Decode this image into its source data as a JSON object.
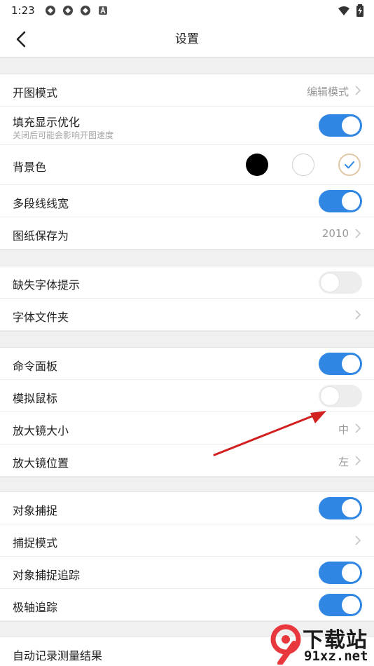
{
  "status_bar": {
    "time": "1:23",
    "notif_icons": [
      "sync-icon",
      "sync-icon",
      "sync-icon",
      "a-box-icon"
    ]
  },
  "header": {
    "title": "设置"
  },
  "settings": {
    "open_mode": {
      "label": "开图模式",
      "value": "编辑模式"
    },
    "fill_optimize": {
      "label": "填充显示优化",
      "sublabel": "关闭后可能会影响开图速度",
      "enabled": true
    },
    "background": {
      "label": "背景色",
      "options": [
        "#000000",
        "#ffffff",
        "#ffffff"
      ],
      "selected_index": 2
    },
    "polyline_width": {
      "label": "多段线线宽",
      "enabled": true
    },
    "save_as": {
      "label": "图纸保存为",
      "value": "2010"
    },
    "missing_font": {
      "label": "缺失字体提示",
      "enabled": false
    },
    "font_folder": {
      "label": "字体文件夹"
    },
    "command_panel": {
      "label": "命令面板",
      "enabled": true
    },
    "simulate_mouse": {
      "label": "模拟鼠标",
      "enabled": false
    },
    "magnifier_size": {
      "label": "放大镜大小",
      "value": "中"
    },
    "magnifier_position": {
      "label": "放大镜位置",
      "value": "左"
    },
    "object_snap": {
      "label": "对象捕捉",
      "enabled": true
    },
    "snap_mode": {
      "label": "捕捉模式"
    },
    "snap_tracking": {
      "label": "对象捕捉追踪",
      "enabled": true
    },
    "polar_tracking": {
      "label": "极轴追踪",
      "enabled": true
    },
    "auto_record": {
      "label": "自动记录测量结果"
    }
  },
  "watermark": {
    "text": "下载站",
    "url_text": "91xz.net"
  },
  "colors": {
    "accent": "#2f86e3",
    "toggle_off": "#ededed",
    "annotation_arrow": "#d21f1f"
  }
}
